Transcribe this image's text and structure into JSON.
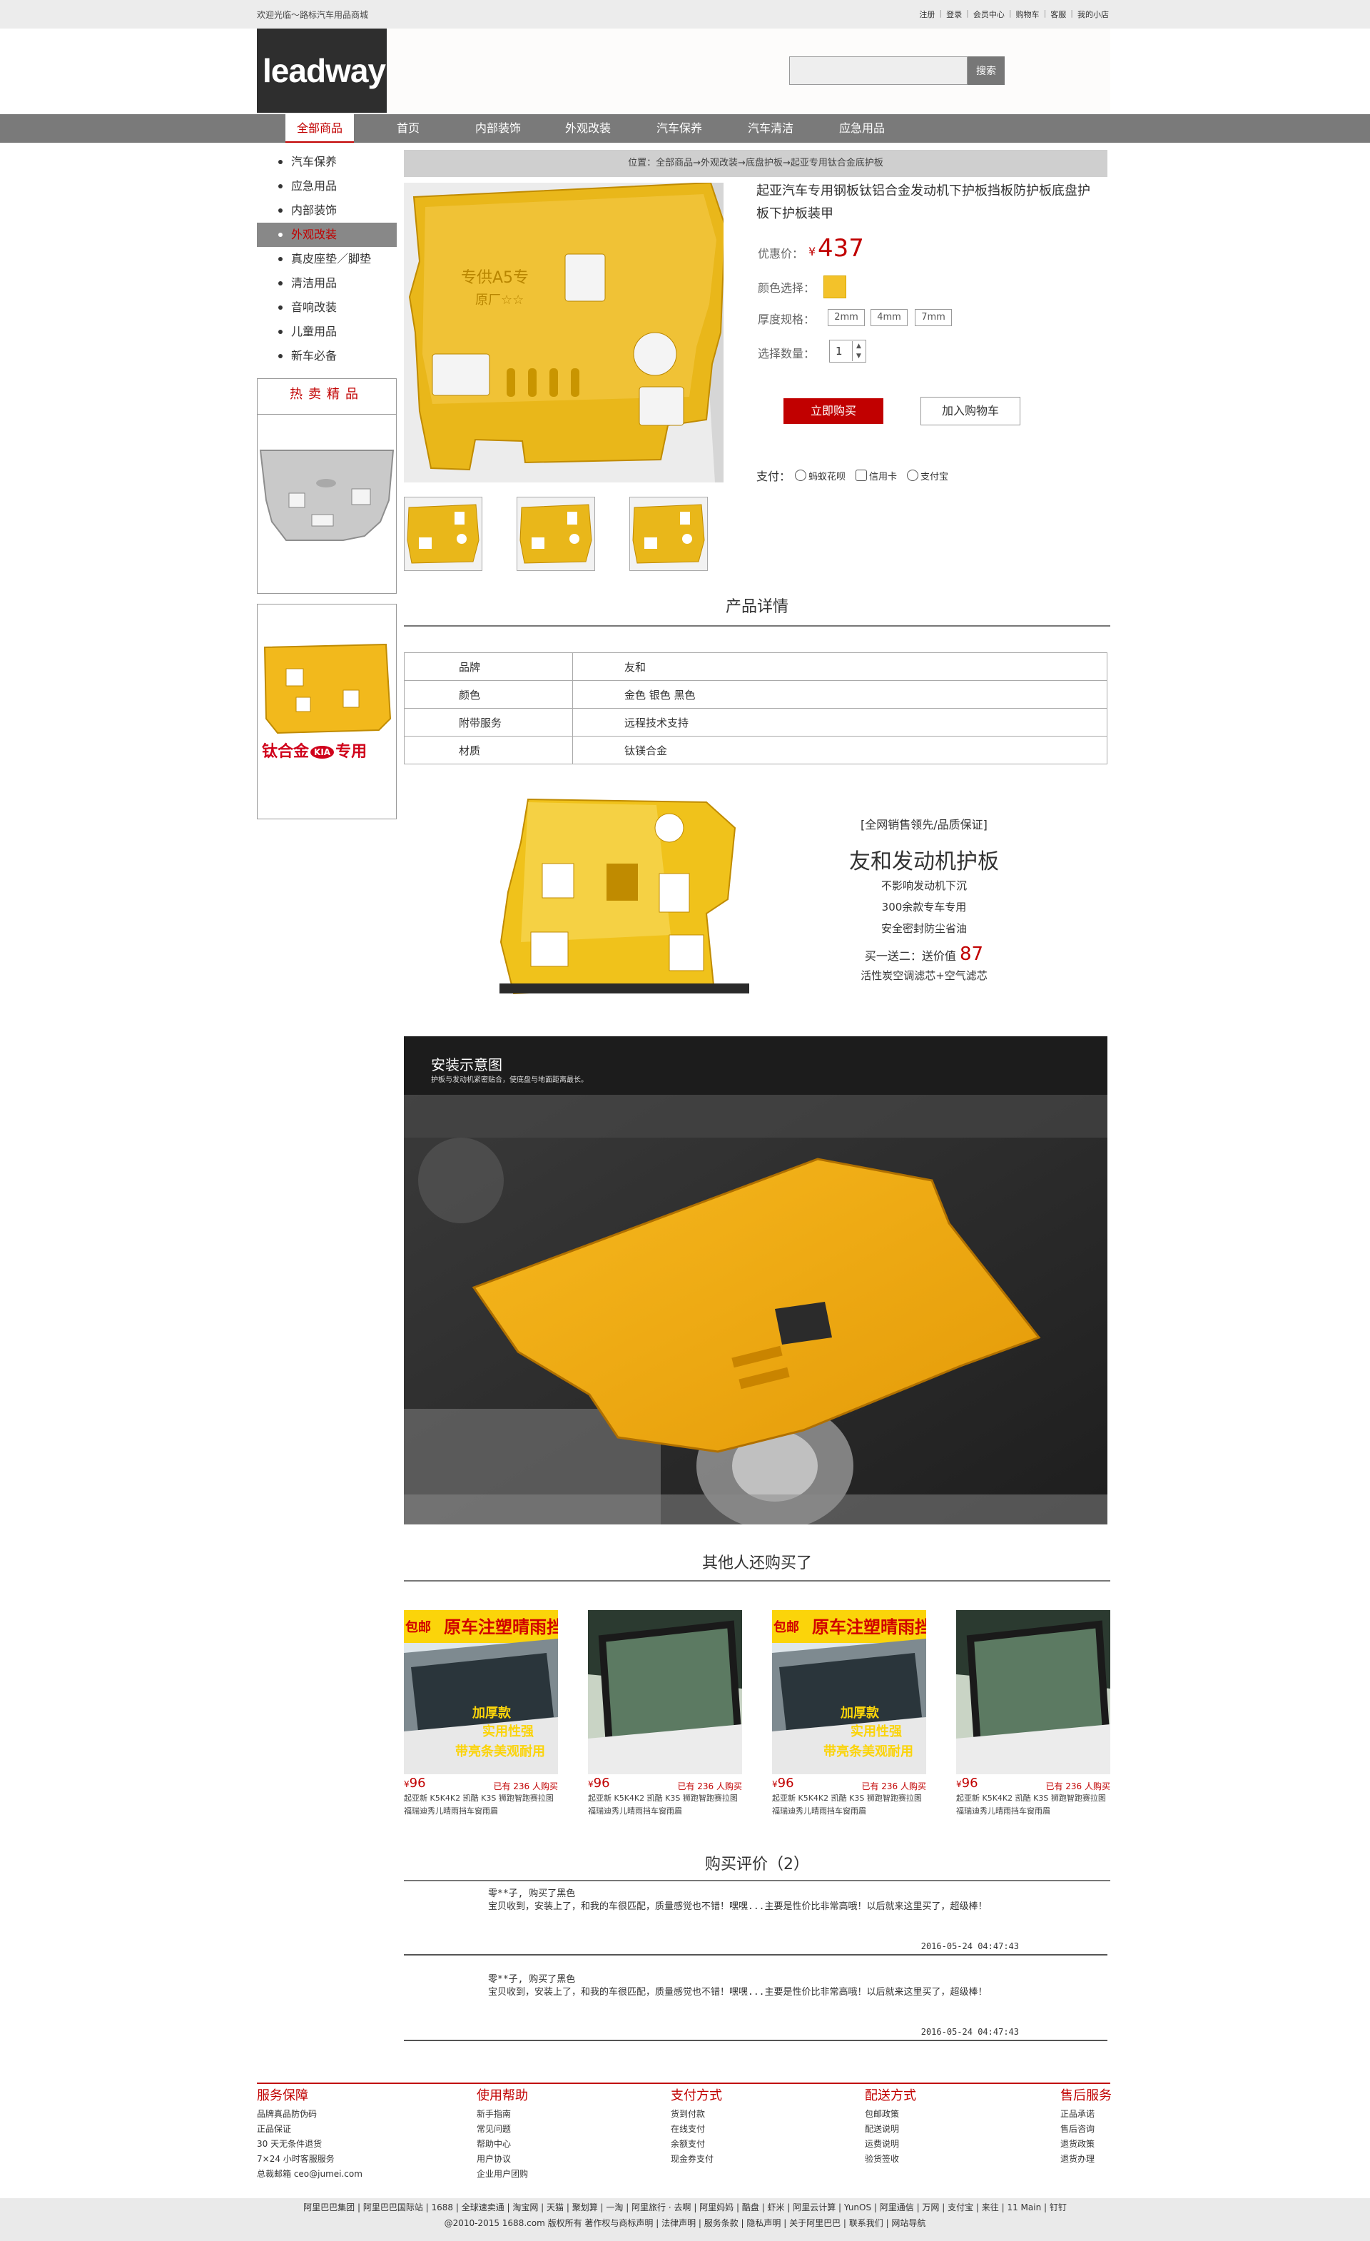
{
  "topbar": {
    "welcome": "欢迎光临～路标汽车用品商城",
    "links": [
      "注册",
      "登录",
      "会员中心",
      "购物车",
      "客服",
      "我的小店"
    ]
  },
  "header": {
    "logo_text": "leadway",
    "search_placeholder": "",
    "search_button": "搜索"
  },
  "nav": {
    "active": "全部商品",
    "items": [
      "首页",
      "内部装饰",
      "外观改装",
      "汽车保养",
      "汽车清洁",
      "应急用品"
    ]
  },
  "sidebar": {
    "items": [
      "汽车保养",
      "应急用品",
      "内部装饰",
      "外观改装",
      "真皮座垫／脚垫",
      "清洁用品",
      "音响改装",
      "儿童用品",
      "新车必备"
    ],
    "active_index": 3,
    "hot_title": "热卖精品",
    "hot_banner_text": "钛合金",
    "hot_banner_brand": "KIA",
    "hot_banner_suffix": "专用"
  },
  "breadcrumb": "位置：全部商品→外观改装→底盘护板→起亚专用钛合金底护板",
  "product": {
    "title": "起亚汽车专用钢板钛铝合金发动机下护板挡板防护板底盘护板下护板装甲",
    "price_label": "优惠价：",
    "price_symbol": "¥",
    "price": "437",
    "color_label": "颜色选择：",
    "color_value": "#f3c22a",
    "spec_label": "厚度规格：",
    "specs": [
      "2mm",
      "4mm",
      "7mm"
    ],
    "qty_label": "选择数量：",
    "qty": "1",
    "buy_button": "立即购买",
    "cart_button": "加入购物车",
    "pay_label": "支付：",
    "pay_methods": [
      "蚂蚁花呗",
      "信用卡",
      "支付宝"
    ],
    "plate_marking": "专供A5专",
    "plate_marking2": "原厂☆☆"
  },
  "details": {
    "title": "产品详情",
    "rows": [
      {
        "k": "品牌",
        "v": "友和"
      },
      {
        "k": "颜色",
        "v": "金色 银色 黑色"
      },
      {
        "k": "附带服务",
        "v": "远程技术支持"
      },
      {
        "k": "材质",
        "v": "钛镁合金"
      }
    ]
  },
  "promo": {
    "tag": "[全网销售领先/品质保证]",
    "headline": "友和发动机护板",
    "points": [
      "不影响发动机下沉",
      "300余款专车专用",
      "安全密封防尘省油"
    ],
    "gift_prefix": "买一送二：送价值",
    "gift_value": "87",
    "gift_items": "活性炭空调滤芯+空气滤芯"
  },
  "install": {
    "title": "安装示意图",
    "subtitle": "护板与发动机紧密贴合，使底盘与地面距离最长。"
  },
  "also_bought": {
    "title": "其他人还购买了",
    "banner_text": "原车注塑晴雨挡",
    "banner_left": "包邮",
    "banner_sub1": "加厚款",
    "banner_sub2": "实用性强",
    "banner_sub3": "带亮条美观耐用",
    "items": [
      {
        "price": "96",
        "sold": "已有 236 人购买",
        "name": "起亚新 K5K4K2 凯酷 K3S 狮跑智跑赛拉图福瑞迪秀儿晴雨挡车窗雨眉"
      },
      {
        "price": "96",
        "sold": "已有 236 人购买",
        "name": "起亚新 K5K4K2 凯酷 K3S 狮跑智跑赛拉图福瑞迪秀儿晴雨挡车窗雨眉"
      },
      {
        "price": "96",
        "sold": "已有 236 人购买",
        "name": "起亚新 K5K4K2 凯酷 K3S 狮跑智跑赛拉图福瑞迪秀儿晴雨挡车窗雨眉"
      },
      {
        "price": "96",
        "sold": "已有 236 人购买",
        "name": "起亚新 K5K4K2 凯酷 K3S 狮跑智跑赛拉图福瑞迪秀儿晴雨挡车窗雨眉"
      }
    ]
  },
  "reviews": {
    "title": "购买评价（2）",
    "items": [
      {
        "user": "零**子, 购买了黑色",
        "content": "宝贝收到，安装上了，和我的车很匹配，质量感觉也不错！嘿嘿...主要是性价比非常高哦！以后就来这里买了，超级棒！",
        "time": "2016-05-24 04:47:43"
      },
      {
        "user": "零**子, 购买了黑色",
        "content": "宝贝收到，安装上了，和我的车很匹配，质量感觉也不错！嘿嘿...主要是性价比非常高哦！以后就来这里买了，超级棒！",
        "time": "2016-05-24 04:47:43"
      }
    ]
  },
  "footer": {
    "columns": [
      {
        "title": "服务保障",
        "items": [
          "品牌真品防伪码",
          "正品保证",
          "30 天无条件退货",
          "7×24 小时客服服务",
          "总裁邮箱 ceo@jumei.com"
        ]
      },
      {
        "title": "使用帮助",
        "items": [
          "新手指南",
          "常见问题",
          "帮助中心",
          "用户协议",
          "企业用户团购"
        ]
      },
      {
        "title": "支付方式",
        "items": [
          "货到付款",
          "在线支付",
          "余额支付",
          "现金券支付"
        ]
      },
      {
        "title": "配送方式",
        "items": [
          "包邮政策",
          "配送说明",
          "运费说明",
          "验货签收"
        ]
      },
      {
        "title": "售后服务",
        "items": [
          "正品承诺",
          "售后咨询",
          "退货政策",
          "退货办理"
        ]
      }
    ],
    "links": "阿里巴巴集团 | 阿里巴巴国际站 | 1688 | 全球速卖通 | 淘宝网 | 天猫 | 聚划算 | 一淘 | 阿里旅行 · 去啊 | 阿里妈妈 | 酷盘 | 虾米 | 阿里云计算 | YunOS | 阿里通信 | 万网 | 支付宝 | 来往 | 11 Main | 钉钉",
    "copyright": "@2010-2015 1688.com 版权所有 著作权与商标声明 | 法律声明 | 服务条款 | 隐私声明 | 关于阿里巴巴 | 联系我们 | 网站导航"
  }
}
